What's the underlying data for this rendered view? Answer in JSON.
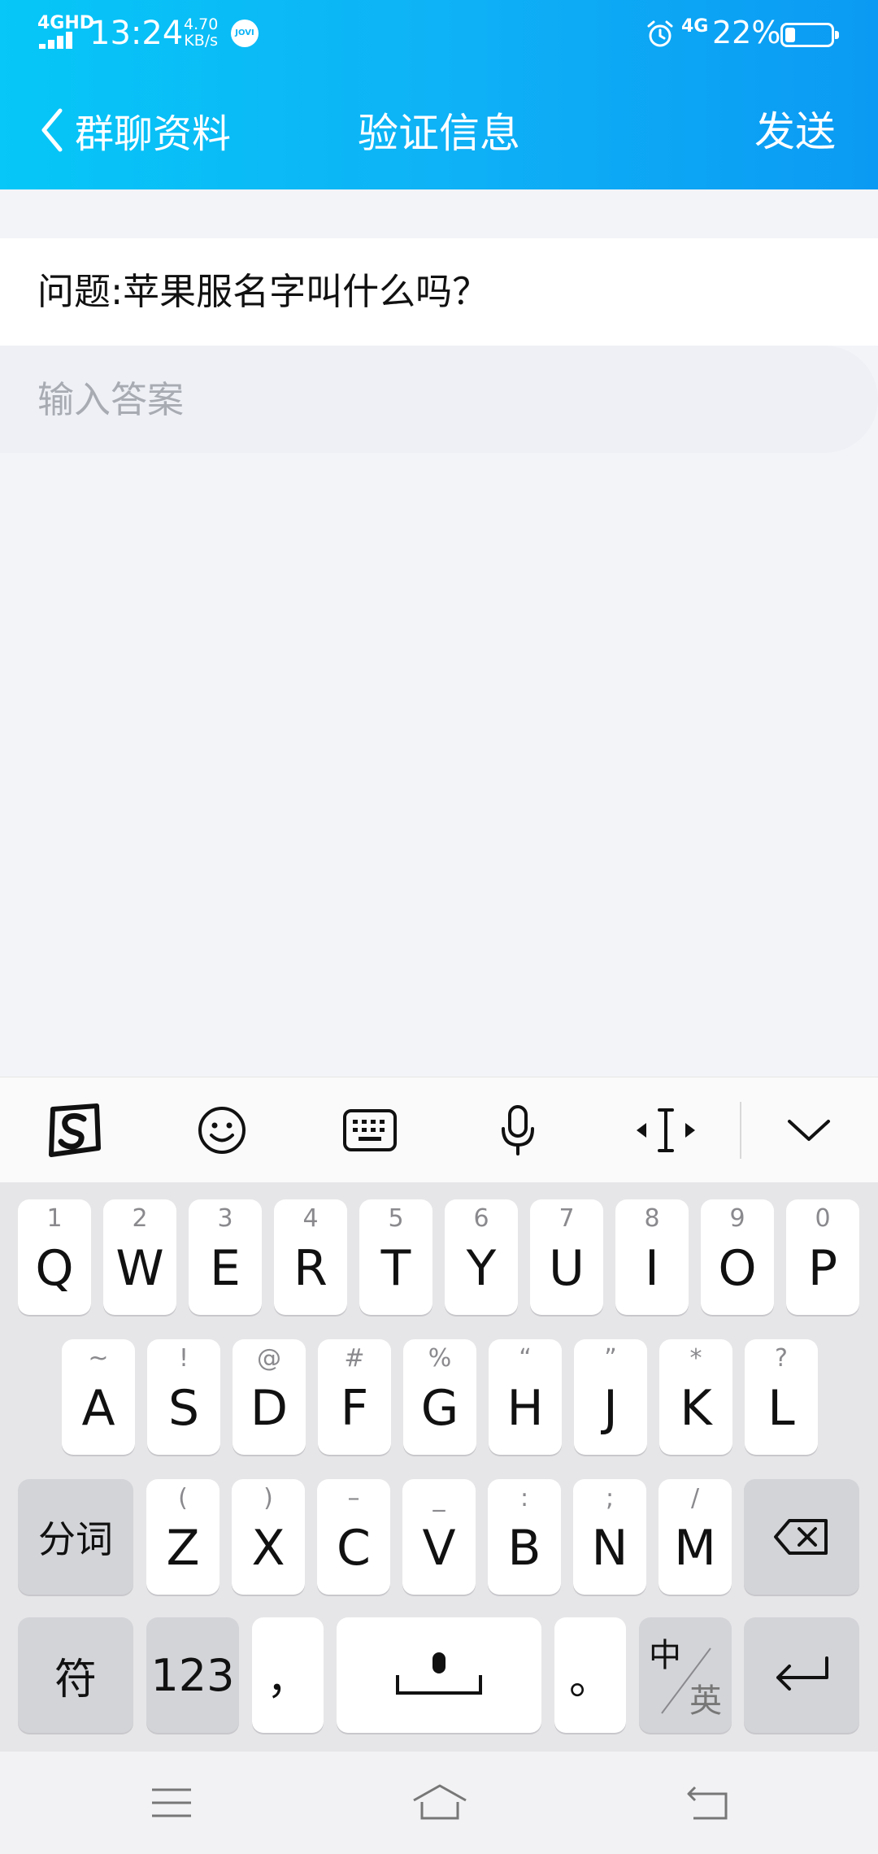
{
  "status_bar": {
    "network": "4GHD",
    "time": "13:24",
    "speed_value": "4.70",
    "speed_unit": "KB/s",
    "jovi": "JOVI",
    "network_right": "4G",
    "battery_percent": "22%",
    "battery_level": 0.22
  },
  "header": {
    "back_label": "群聊资料",
    "title": "验证信息",
    "send_label": "发送"
  },
  "form": {
    "question": "问题:苹果服名字叫什么吗？",
    "answer_value": "",
    "answer_placeholder": "输入答案"
  },
  "toolbar": {
    "items": [
      "sogou-logo-icon",
      "emoji-icon",
      "keyboard-icon",
      "microphone-icon",
      "cursor-move-icon",
      "chevron-down-icon"
    ]
  },
  "keyboard": {
    "row1": [
      {
        "main": "Q",
        "sub": "1"
      },
      {
        "main": "W",
        "sub": "2"
      },
      {
        "main": "E",
        "sub": "3"
      },
      {
        "main": "R",
        "sub": "4"
      },
      {
        "main": "T",
        "sub": "5"
      },
      {
        "main": "Y",
        "sub": "6"
      },
      {
        "main": "U",
        "sub": "7"
      },
      {
        "main": "I",
        "sub": "8"
      },
      {
        "main": "O",
        "sub": "9"
      },
      {
        "main": "P",
        "sub": "0"
      }
    ],
    "row2": [
      {
        "main": "A",
        "sub": "~"
      },
      {
        "main": "S",
        "sub": "!"
      },
      {
        "main": "D",
        "sub": "@"
      },
      {
        "main": "F",
        "sub": "#"
      },
      {
        "main": "G",
        "sub": "%"
      },
      {
        "main": "H",
        "sub": "“"
      },
      {
        "main": "J",
        "sub": "”"
      },
      {
        "main": "K",
        "sub": "*"
      },
      {
        "main": "L",
        "sub": "?"
      }
    ],
    "row3": [
      {
        "main": "Z",
        "sub": "("
      },
      {
        "main": "X",
        "sub": ")"
      },
      {
        "main": "C",
        "sub": "–"
      },
      {
        "main": "V",
        "sub": "_"
      },
      {
        "main": "B",
        "sub": ":"
      },
      {
        "main": "N",
        "sub": ";"
      },
      {
        "main": "M",
        "sub": "/"
      }
    ],
    "fenci": "分词",
    "fu": "符",
    "num": "123",
    "comma": "，",
    "period": "。",
    "zh": "中",
    "en": "英"
  },
  "nav": {
    "items": [
      "menu-icon",
      "home-icon",
      "back-icon"
    ]
  }
}
